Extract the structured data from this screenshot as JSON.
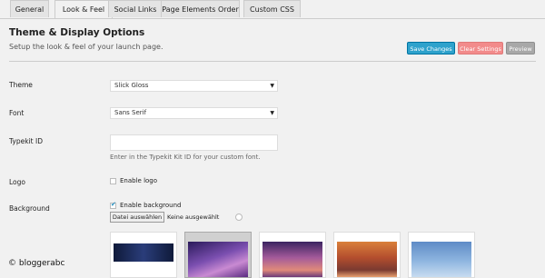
{
  "tabs": [
    {
      "label": "General"
    },
    {
      "label": "Look & Feel",
      "active": true
    },
    {
      "label": "Social Links"
    },
    {
      "label": "Page Elements Order"
    },
    {
      "label": "Custom CSS"
    }
  ],
  "header": {
    "title": "Theme & Display Options",
    "subtitle": "Setup the look & feel of your launch page."
  },
  "actions": {
    "save_label": "Save Changes",
    "clear_label": "Clear Settings",
    "preview_label": "Preview"
  },
  "fields": {
    "theme": {
      "label": "Theme",
      "value": "Slick Gloss"
    },
    "font": {
      "label": "Font",
      "value": "Sans Serif"
    },
    "typekit": {
      "label": "Typekit ID",
      "value": "",
      "hint": "Enter in the Typekit Kit ID for your custom font."
    },
    "logo": {
      "label": "Logo",
      "checkbox_label": "Enable logo",
      "checked": false
    },
    "background": {
      "label": "Background",
      "checkbox_label": "Enable background",
      "checked": true,
      "file_button_label": "Datei auswählen",
      "file_status": "Keine ausgewählt"
    }
  },
  "thumbnails": [
    {
      "name": "bg-1"
    },
    {
      "name": "bg-2",
      "selected": true
    },
    {
      "name": "bg-3"
    },
    {
      "name": "bg-4"
    },
    {
      "name": "bg-5"
    }
  ],
  "watermark": "© bloggerabc",
  "colors": {
    "save": "#2ea2cc",
    "clear": "#f28b8b",
    "preview": "#a8a8a8",
    "checkmark": "#1e8cbe"
  }
}
